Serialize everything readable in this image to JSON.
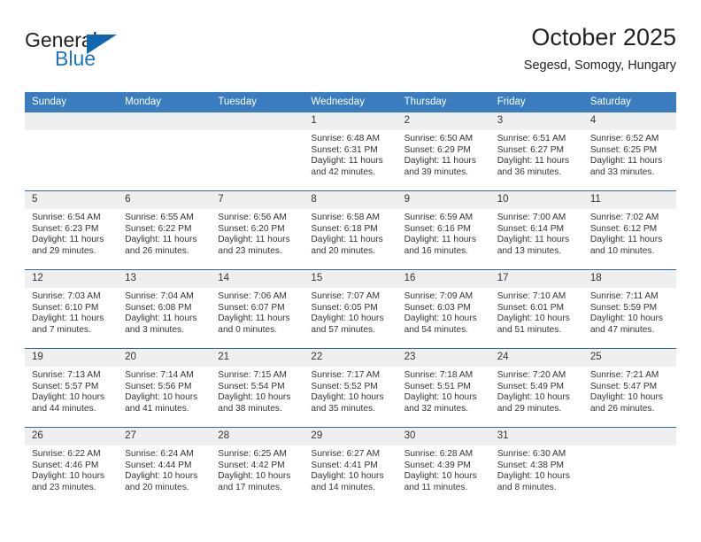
{
  "logo": {
    "word_one": "General",
    "word_two": "Blue",
    "accent_color": "#1166b0"
  },
  "header": {
    "title": "October 2025",
    "subtitle": "Segesd, Somogy, Hungary"
  },
  "theme": {
    "header_row_bg": "#3a7dbf",
    "week_divider": "#2e6da4",
    "daynum_band_bg": "#efefef",
    "text": "#333333"
  },
  "weekday_headers": [
    "Sunday",
    "Monday",
    "Tuesday",
    "Wednesday",
    "Thursday",
    "Friday",
    "Saturday"
  ],
  "weeks": [
    [
      {
        "day": "",
        "blank": true,
        "sunrise": "",
        "sunset": "",
        "daylight_line1": "",
        "daylight_line2": ""
      },
      {
        "day": "",
        "blank": true,
        "sunrise": "",
        "sunset": "",
        "daylight_line1": "",
        "daylight_line2": ""
      },
      {
        "day": "",
        "blank": true,
        "sunrise": "",
        "sunset": "",
        "daylight_line1": "",
        "daylight_line2": ""
      },
      {
        "day": "1",
        "blank": false,
        "sunrise": "Sunrise: 6:48 AM",
        "sunset": "Sunset: 6:31 PM",
        "daylight_line1": "Daylight: 11 hours",
        "daylight_line2": "and 42 minutes."
      },
      {
        "day": "2",
        "blank": false,
        "sunrise": "Sunrise: 6:50 AM",
        "sunset": "Sunset: 6:29 PM",
        "daylight_line1": "Daylight: 11 hours",
        "daylight_line2": "and 39 minutes."
      },
      {
        "day": "3",
        "blank": false,
        "sunrise": "Sunrise: 6:51 AM",
        "sunset": "Sunset: 6:27 PM",
        "daylight_line1": "Daylight: 11 hours",
        "daylight_line2": "and 36 minutes."
      },
      {
        "day": "4",
        "blank": false,
        "sunrise": "Sunrise: 6:52 AM",
        "sunset": "Sunset: 6:25 PM",
        "daylight_line1": "Daylight: 11 hours",
        "daylight_line2": "and 33 minutes."
      }
    ],
    [
      {
        "day": "5",
        "blank": false,
        "sunrise": "Sunrise: 6:54 AM",
        "sunset": "Sunset: 6:23 PM",
        "daylight_line1": "Daylight: 11 hours",
        "daylight_line2": "and 29 minutes."
      },
      {
        "day": "6",
        "blank": false,
        "sunrise": "Sunrise: 6:55 AM",
        "sunset": "Sunset: 6:22 PM",
        "daylight_line1": "Daylight: 11 hours",
        "daylight_line2": "and 26 minutes."
      },
      {
        "day": "7",
        "blank": false,
        "sunrise": "Sunrise: 6:56 AM",
        "sunset": "Sunset: 6:20 PM",
        "daylight_line1": "Daylight: 11 hours",
        "daylight_line2": "and 23 minutes."
      },
      {
        "day": "8",
        "blank": false,
        "sunrise": "Sunrise: 6:58 AM",
        "sunset": "Sunset: 6:18 PM",
        "daylight_line1": "Daylight: 11 hours",
        "daylight_line2": "and 20 minutes."
      },
      {
        "day": "9",
        "blank": false,
        "sunrise": "Sunrise: 6:59 AM",
        "sunset": "Sunset: 6:16 PM",
        "daylight_line1": "Daylight: 11 hours",
        "daylight_line2": "and 16 minutes."
      },
      {
        "day": "10",
        "blank": false,
        "sunrise": "Sunrise: 7:00 AM",
        "sunset": "Sunset: 6:14 PM",
        "daylight_line1": "Daylight: 11 hours",
        "daylight_line2": "and 13 minutes."
      },
      {
        "day": "11",
        "blank": false,
        "sunrise": "Sunrise: 7:02 AM",
        "sunset": "Sunset: 6:12 PM",
        "daylight_line1": "Daylight: 11 hours",
        "daylight_line2": "and 10 minutes."
      }
    ],
    [
      {
        "day": "12",
        "blank": false,
        "sunrise": "Sunrise: 7:03 AM",
        "sunset": "Sunset: 6:10 PM",
        "daylight_line1": "Daylight: 11 hours",
        "daylight_line2": "and 7 minutes."
      },
      {
        "day": "13",
        "blank": false,
        "sunrise": "Sunrise: 7:04 AM",
        "sunset": "Sunset: 6:08 PM",
        "daylight_line1": "Daylight: 11 hours",
        "daylight_line2": "and 3 minutes."
      },
      {
        "day": "14",
        "blank": false,
        "sunrise": "Sunrise: 7:06 AM",
        "sunset": "Sunset: 6:07 PM",
        "daylight_line1": "Daylight: 11 hours",
        "daylight_line2": "and 0 minutes."
      },
      {
        "day": "15",
        "blank": false,
        "sunrise": "Sunrise: 7:07 AM",
        "sunset": "Sunset: 6:05 PM",
        "daylight_line1": "Daylight: 10 hours",
        "daylight_line2": "and 57 minutes."
      },
      {
        "day": "16",
        "blank": false,
        "sunrise": "Sunrise: 7:09 AM",
        "sunset": "Sunset: 6:03 PM",
        "daylight_line1": "Daylight: 10 hours",
        "daylight_line2": "and 54 minutes."
      },
      {
        "day": "17",
        "blank": false,
        "sunrise": "Sunrise: 7:10 AM",
        "sunset": "Sunset: 6:01 PM",
        "daylight_line1": "Daylight: 10 hours",
        "daylight_line2": "and 51 minutes."
      },
      {
        "day": "18",
        "blank": false,
        "sunrise": "Sunrise: 7:11 AM",
        "sunset": "Sunset: 5:59 PM",
        "daylight_line1": "Daylight: 10 hours",
        "daylight_line2": "and 47 minutes."
      }
    ],
    [
      {
        "day": "19",
        "blank": false,
        "sunrise": "Sunrise: 7:13 AM",
        "sunset": "Sunset: 5:57 PM",
        "daylight_line1": "Daylight: 10 hours",
        "daylight_line2": "and 44 minutes."
      },
      {
        "day": "20",
        "blank": false,
        "sunrise": "Sunrise: 7:14 AM",
        "sunset": "Sunset: 5:56 PM",
        "daylight_line1": "Daylight: 10 hours",
        "daylight_line2": "and 41 minutes."
      },
      {
        "day": "21",
        "blank": false,
        "sunrise": "Sunrise: 7:15 AM",
        "sunset": "Sunset: 5:54 PM",
        "daylight_line1": "Daylight: 10 hours",
        "daylight_line2": "and 38 minutes."
      },
      {
        "day": "22",
        "blank": false,
        "sunrise": "Sunrise: 7:17 AM",
        "sunset": "Sunset: 5:52 PM",
        "daylight_line1": "Daylight: 10 hours",
        "daylight_line2": "and 35 minutes."
      },
      {
        "day": "23",
        "blank": false,
        "sunrise": "Sunrise: 7:18 AM",
        "sunset": "Sunset: 5:51 PM",
        "daylight_line1": "Daylight: 10 hours",
        "daylight_line2": "and 32 minutes."
      },
      {
        "day": "24",
        "blank": false,
        "sunrise": "Sunrise: 7:20 AM",
        "sunset": "Sunset: 5:49 PM",
        "daylight_line1": "Daylight: 10 hours",
        "daylight_line2": "and 29 minutes."
      },
      {
        "day": "25",
        "blank": false,
        "sunrise": "Sunrise: 7:21 AM",
        "sunset": "Sunset: 5:47 PM",
        "daylight_line1": "Daylight: 10 hours",
        "daylight_line2": "and 26 minutes."
      }
    ],
    [
      {
        "day": "26",
        "blank": false,
        "sunrise": "Sunrise: 6:22 AM",
        "sunset": "Sunset: 4:46 PM",
        "daylight_line1": "Daylight: 10 hours",
        "daylight_line2": "and 23 minutes."
      },
      {
        "day": "27",
        "blank": false,
        "sunrise": "Sunrise: 6:24 AM",
        "sunset": "Sunset: 4:44 PM",
        "daylight_line1": "Daylight: 10 hours",
        "daylight_line2": "and 20 minutes."
      },
      {
        "day": "28",
        "blank": false,
        "sunrise": "Sunrise: 6:25 AM",
        "sunset": "Sunset: 4:42 PM",
        "daylight_line1": "Daylight: 10 hours",
        "daylight_line2": "and 17 minutes."
      },
      {
        "day": "29",
        "blank": false,
        "sunrise": "Sunrise: 6:27 AM",
        "sunset": "Sunset: 4:41 PM",
        "daylight_line1": "Daylight: 10 hours",
        "daylight_line2": "and 14 minutes."
      },
      {
        "day": "30",
        "blank": false,
        "sunrise": "Sunrise: 6:28 AM",
        "sunset": "Sunset: 4:39 PM",
        "daylight_line1": "Daylight: 10 hours",
        "daylight_line2": "and 11 minutes."
      },
      {
        "day": "31",
        "blank": false,
        "sunrise": "Sunrise: 6:30 AM",
        "sunset": "Sunset: 4:38 PM",
        "daylight_line1": "Daylight: 10 hours",
        "daylight_line2": "and 8 minutes."
      },
      {
        "day": "",
        "blank": true,
        "sunrise": "",
        "sunset": "",
        "daylight_line1": "",
        "daylight_line2": ""
      }
    ]
  ]
}
